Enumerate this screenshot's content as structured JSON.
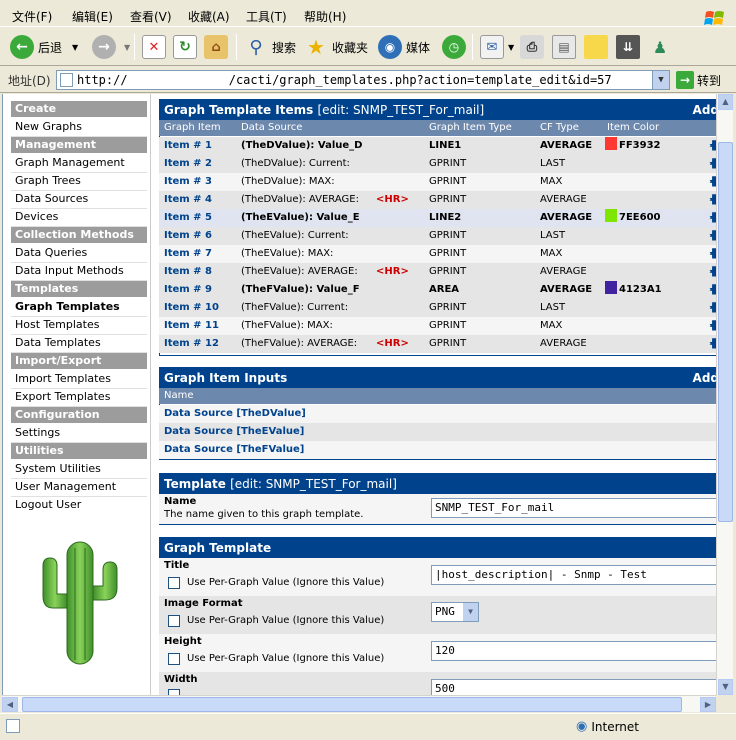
{
  "menu": [
    "文件(F)",
    "编辑(E)",
    "查看(V)",
    "收藏(A)",
    "工具(T)",
    "帮助(H)"
  ],
  "toolbar": {
    "back": "后退",
    "search": "搜索",
    "favorites": "收藏夹",
    "media": "媒体"
  },
  "address": {
    "label": "地址(D)",
    "url": "http://              /cacti/graph_templates.php?action=template_edit&id=57",
    "go": "转到"
  },
  "nav": {
    "create": "Create",
    "new_graphs": "New Graphs",
    "management": "Management",
    "graph_management": "Graph Management",
    "graph_trees": "Graph Trees",
    "data_sources": "Data Sources",
    "devices": "Devices",
    "collection_methods": "Collection Methods",
    "data_queries": "Data Queries",
    "data_input_methods": "Data Input Methods",
    "templates": "Templates",
    "graph_templates": "Graph Templates",
    "host_templates": "Host Templates",
    "data_templates": "Data Templates",
    "import_export": "Import/Export",
    "import_templates": "Import Templates",
    "export_templates": "Export Templates",
    "configuration": "Configuration",
    "settings": "Settings",
    "utilities": "Utilities",
    "system_utilities": "System Utilities",
    "user_management": "User Management",
    "logout_user": "Logout User"
  },
  "items_panel": {
    "title": "Graph Template Items",
    "subtitle": "[edit: SNMP_TEST_For_mail]",
    "add": "Add",
    "columns": {
      "item": "Graph Item",
      "source": "Data Source",
      "type": "Graph Item Type",
      "cf": "CF Type",
      "color": "Item Color"
    },
    "rows": [
      {
        "item": "Item # 1",
        "source": "(TheDValue): Value_D",
        "hr": "",
        "type": "LINE1",
        "cf": "AVERAGE",
        "color": "FF3932",
        "hex": "#FF3932",
        "bold": true
      },
      {
        "item": "Item # 2",
        "source": "(TheDValue): Current:",
        "hr": "",
        "type": "GPRINT",
        "cf": "LAST",
        "color": "",
        "hex": "",
        "bold": false
      },
      {
        "item": "Item # 3",
        "source": "(TheDValue): MAX:",
        "hr": "",
        "type": "GPRINT",
        "cf": "MAX",
        "color": "",
        "hex": "",
        "bold": false
      },
      {
        "item": "Item # 4",
        "source": "(TheDValue): AVERAGE:",
        "hr": "<HR>",
        "type": "GPRINT",
        "cf": "AVERAGE",
        "color": "",
        "hex": "",
        "bold": false
      },
      {
        "item": "Item # 5",
        "source": "(TheEValue): Value_E",
        "hr": "",
        "type": "LINE2",
        "cf": "AVERAGE",
        "color": "7EE600",
        "hex": "#7EE600",
        "bold": true
      },
      {
        "item": "Item # 6",
        "source": "(TheEValue): Current:",
        "hr": "",
        "type": "GPRINT",
        "cf": "LAST",
        "color": "",
        "hex": "",
        "bold": false
      },
      {
        "item": "Item # 7",
        "source": "(TheEValue): MAX:",
        "hr": "",
        "type": "GPRINT",
        "cf": "MAX",
        "color": "",
        "hex": "",
        "bold": false
      },
      {
        "item": "Item # 8",
        "source": "(TheEValue): AVERAGE:",
        "hr": "<HR>",
        "type": "GPRINT",
        "cf": "AVERAGE",
        "color": "",
        "hex": "",
        "bold": false
      },
      {
        "item": "Item # 9",
        "source": "(TheFValue): Value_F",
        "hr": "",
        "type": "AREA",
        "cf": "AVERAGE",
        "color": "4123A1",
        "hex": "#4123A1",
        "bold": true
      },
      {
        "item": "Item # 10",
        "source": "(TheFValue): Current:",
        "hr": "",
        "type": "GPRINT",
        "cf": "LAST",
        "color": "",
        "hex": "",
        "bold": false
      },
      {
        "item": "Item # 11",
        "source": "(TheFValue): MAX:",
        "hr": "",
        "type": "GPRINT",
        "cf": "MAX",
        "color": "",
        "hex": "",
        "bold": false
      },
      {
        "item": "Item # 12",
        "source": "(TheFValue): AVERAGE:",
        "hr": "<HR>",
        "type": "GPRINT",
        "cf": "AVERAGE",
        "color": "",
        "hex": "",
        "bold": false
      }
    ]
  },
  "inputs_panel": {
    "title": "Graph Item Inputs",
    "add": "Add",
    "column": "Name",
    "rows": [
      "Data Source [TheDValue]",
      "Data Source [TheEValue]",
      "Data Source [TheFValue]"
    ]
  },
  "template_panel": {
    "title": "Template",
    "subtitle": "[edit: SNMP_TEST_For_mail]",
    "name_label": "Name",
    "name_desc": "The name given to this graph template.",
    "name_value": "SNMP_TEST_For_mail"
  },
  "graph_template_panel": {
    "title": "Graph Template",
    "per_graph": "Use Per-Graph Value (Ignore this Value)",
    "title_label": "Title",
    "title_value": "|host_description| - Snmp - Test",
    "format_label": "Image Format",
    "format_value": "PNG",
    "height_label": "Height",
    "height_value": "120",
    "width_label": "Width",
    "width_value": "500"
  },
  "status": {
    "zone": "Internet"
  }
}
